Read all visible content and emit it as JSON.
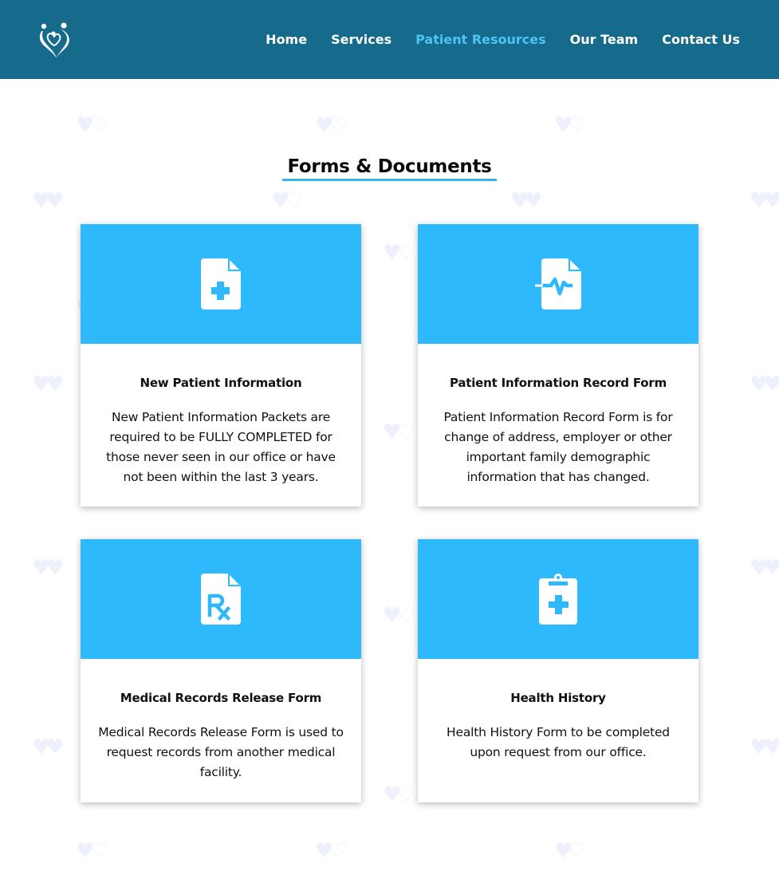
{
  "nav": {
    "logo_icon": "family-heart-logo-icon",
    "items": [
      {
        "label": "Home",
        "active": false
      },
      {
        "label": "Services",
        "active": false
      },
      {
        "label": "Patient Resources",
        "active": true
      },
      {
        "label": "Our Team",
        "active": false
      },
      {
        "label": "Contact Us",
        "active": false
      }
    ]
  },
  "main": {
    "title": "Forms & Documents",
    "cards": [
      {
        "icon": "document-plus-icon",
        "title": "New Patient Information",
        "text": "New Patient Information Packets are required to be FULLY COMPLETED for those never seen in our office or have not been within the last 3 years."
      },
      {
        "icon": "document-heartbeat-icon",
        "title": "Patient Information Record Form",
        "text": "Patient Information Record Form is for change of address, employer or other important family demographic information that has changed."
      },
      {
        "icon": "prescription-document-icon",
        "title": "Medical Records Release Form",
        "text": "Medical Records Release Form is used to request records from another medical facility."
      },
      {
        "icon": "clipboard-plus-icon",
        "title": "Health History",
        "text": "Health History Form to be completed upon request from our office."
      }
    ]
  },
  "colors": {
    "navbar": "#166a8c",
    "active_link": "#4cc4f5",
    "card_header": "#2db9fc",
    "title_underline": "#33b5ee",
    "pattern": "#eef0fc"
  }
}
